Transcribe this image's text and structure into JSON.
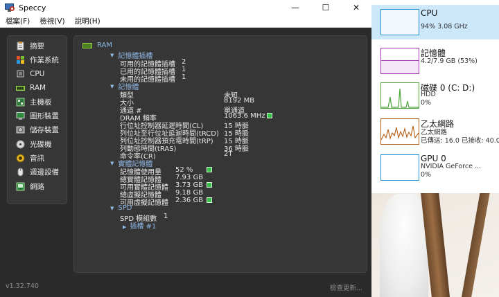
{
  "window": {
    "title": "Speccy",
    "controls": {
      "minimize": "—",
      "maximize": "☐",
      "close": "✕"
    }
  },
  "menu": [
    "檔案(F)",
    "檢視(V)",
    "說明(H)"
  ],
  "nav": [
    {
      "label": "摘要",
      "icon": "clipboard-icon"
    },
    {
      "label": "作業系統",
      "icon": "windows-icon"
    },
    {
      "label": "CPU",
      "icon": "cpu-icon"
    },
    {
      "label": "RAM",
      "icon": "ram-icon"
    },
    {
      "label": "主機板",
      "icon": "motherboard-icon"
    },
    {
      "label": "圖形裝置",
      "icon": "monitor-icon"
    },
    {
      "label": "儲存裝置",
      "icon": "harddisk-icon"
    },
    {
      "label": "光碟機",
      "icon": "optical-disc-icon"
    },
    {
      "label": "音訊",
      "icon": "speaker-icon"
    },
    {
      "label": "週邊設備",
      "icon": "mouse-icon"
    },
    {
      "label": "網路",
      "icon": "network-icon"
    }
  ],
  "content": {
    "header": "RAM",
    "slots": {
      "title": "記憶體插槽",
      "rows": [
        {
          "label": "可用的記憶體插槽",
          "value": "2"
        },
        {
          "label": "已用的記憶體插槽",
          "value": "1"
        },
        {
          "label": "未用的記憶體插槽",
          "value": "1"
        }
      ]
    },
    "memory": {
      "title": "記憶體",
      "rows": [
        {
          "label": "類型",
          "value": "未知"
        },
        {
          "label": "大小",
          "value": "8192 MB"
        },
        {
          "label": "通道 #",
          "value": "單通道"
        },
        {
          "label": "DRAM 頻率",
          "value": "1063.6 MHz"
        },
        {
          "label": "行位址控制器延遲時間(CL)",
          "value": "15 時脈"
        },
        {
          "label": "列位址至行位址延遲時間(tRCD)",
          "value": "15 時脈"
        },
        {
          "label": "列位址控制器預充電時間(tRP)",
          "value": "15 時脈"
        },
        {
          "label": "列動態時間(tRAS)",
          "value": "36 時脈"
        },
        {
          "label": "命令率(CR)",
          "value": "2T"
        }
      ]
    },
    "physical": {
      "title": "實體記憶體",
      "rows": [
        {
          "label": "記憶體使用量",
          "value": "52 %"
        },
        {
          "label": "總實體記憶體",
          "value": "7.93 GB"
        },
        {
          "label": "可用實體記憶體",
          "value": "3.73 GB"
        },
        {
          "label": "總虛擬記憶體",
          "value": "9.18 GB"
        },
        {
          "label": "可用虛擬記憶體",
          "value": "2.36 GB"
        }
      ]
    },
    "spd": {
      "title": "SPD",
      "module_label": "SPD 模組數",
      "module_value": "1",
      "slot_label": "插槽 #1"
    }
  },
  "statusbar": {
    "version": "v1.32.740",
    "update": "檢查更新..."
  },
  "taskmanager": [
    {
      "name": "CPU",
      "line1": "94%  3.08 GHz",
      "color": "#1f8fd8"
    },
    {
      "name": "記憶體",
      "line1": "4.2/7.9 GB (53%)",
      "color": "#a432b4"
    },
    {
      "name": "磁碟 0 (C: D:)",
      "line1": "HDD",
      "line2": "0%",
      "color": "#4da53c"
    },
    {
      "name": "乙太網路",
      "line1": "乙太網路",
      "line2": "已傳送: 16.0  已接收: 40.0",
      "color": "#b55d14"
    },
    {
      "name": "GPU 0",
      "line1": "NVIDIA GeForce ...",
      "line2": "0%",
      "color": "#1f8fd8"
    }
  ]
}
